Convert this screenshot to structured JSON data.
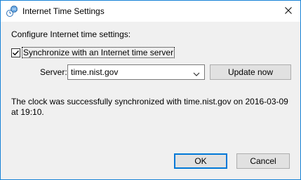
{
  "window": {
    "title": "Internet Time Settings",
    "icon": "clock-globe-icon",
    "close_icon": "close-icon"
  },
  "dialog": {
    "heading": "Configure Internet time settings:",
    "sync_checkbox": {
      "label": "Synchronize with an Internet time server",
      "checked": true
    },
    "server": {
      "label": "Server:",
      "value": "time.nist.gov"
    },
    "update_button": "Update now",
    "status": "The clock was successfully synchronized with time.nist.gov on 2016-03-09 at 19:10.",
    "ok_button": "OK",
    "cancel_button": "Cancel"
  },
  "colors": {
    "window_border": "#1883d7",
    "dialog_background": "#f0f0f0",
    "default_button_border": "#0078d7"
  }
}
